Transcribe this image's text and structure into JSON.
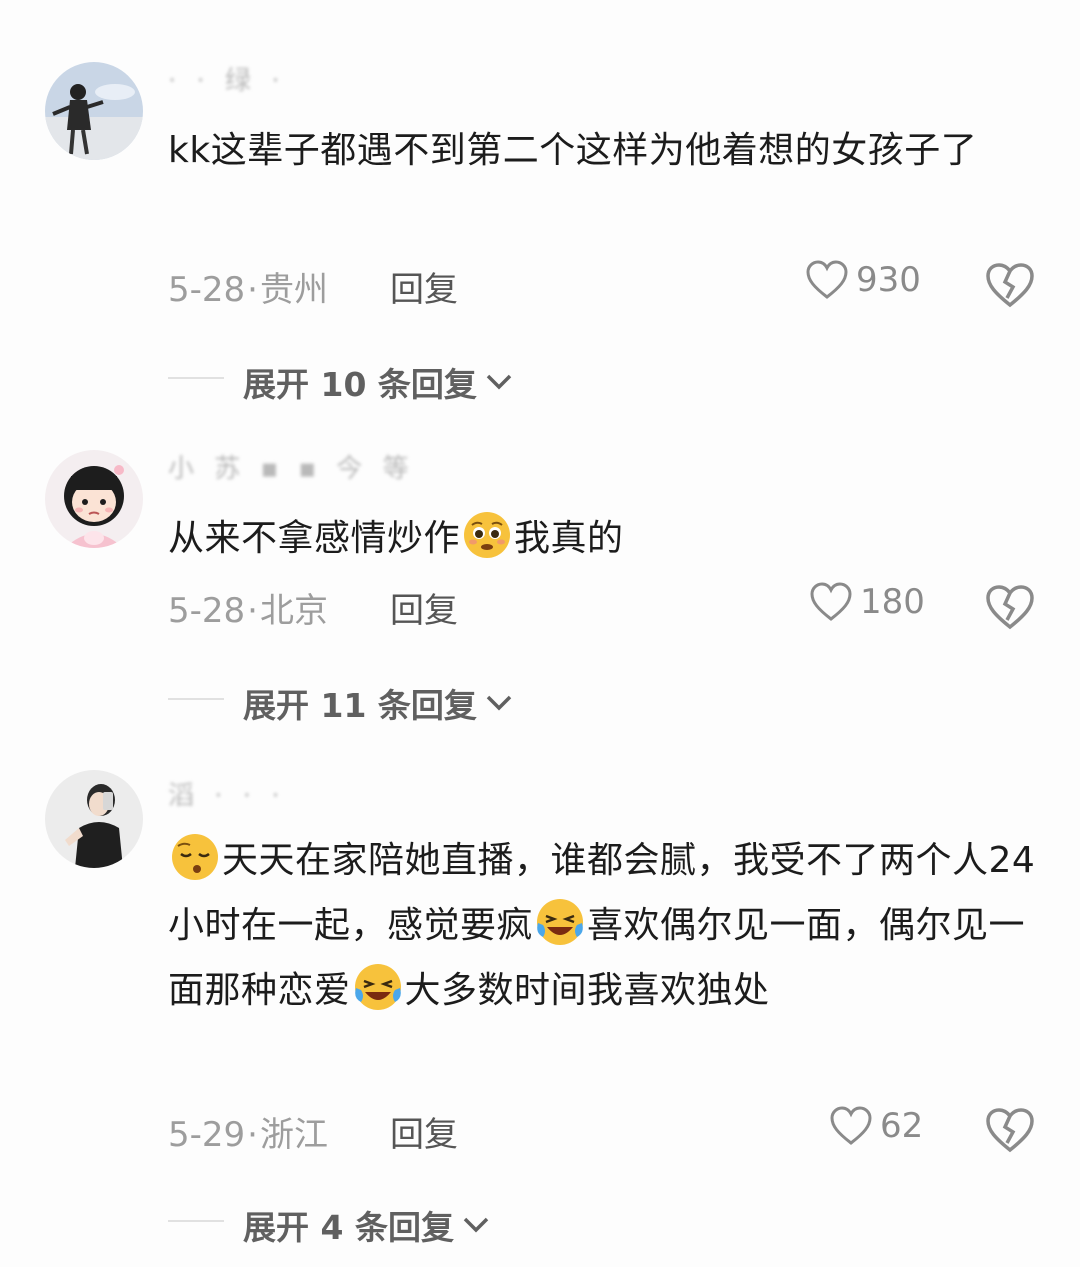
{
  "comments": [
    {
      "username": "· · 绿 ·",
      "text": "kk这辈子都遇不到第二个这样为他着想的女孩子了",
      "date": "5-28",
      "location": "贵州",
      "reply": "回复",
      "likes": "930",
      "expand": "展开 10 条回复"
    },
    {
      "username": "小 苏 ▪ ▪ 今 等",
      "text_before": "从来不拿感情炒作",
      "emoji": "pleading-face",
      "text_after": "我真的",
      "date": "5-28",
      "location": "北京",
      "reply": "回复",
      "likes": "180",
      "expand": "展开 11 条回复"
    },
    {
      "username": "滔 · · ·",
      "emoji_start": "sleepy-face",
      "segment1": "天天在家陪她直播，谁都会腻，我受不了两个人24小时在一起，感觉要疯",
      "emoji_mid1": "laughing-crying-face",
      "segment2": "喜欢偶尔见一面，偶尔见一面那种恋爱",
      "emoji_mid2": "laughing-crying-face",
      "segment3": "大多数时间我喜欢独处",
      "date": "5-29",
      "location": "浙江",
      "reply": "回复",
      "likes": "62",
      "expand": "展开 4 条回复"
    }
  ],
  "separator": "·",
  "colors": {
    "text": "#1c1c1c",
    "meta": "#9d9d9d",
    "emoji": "#f7c23c"
  }
}
